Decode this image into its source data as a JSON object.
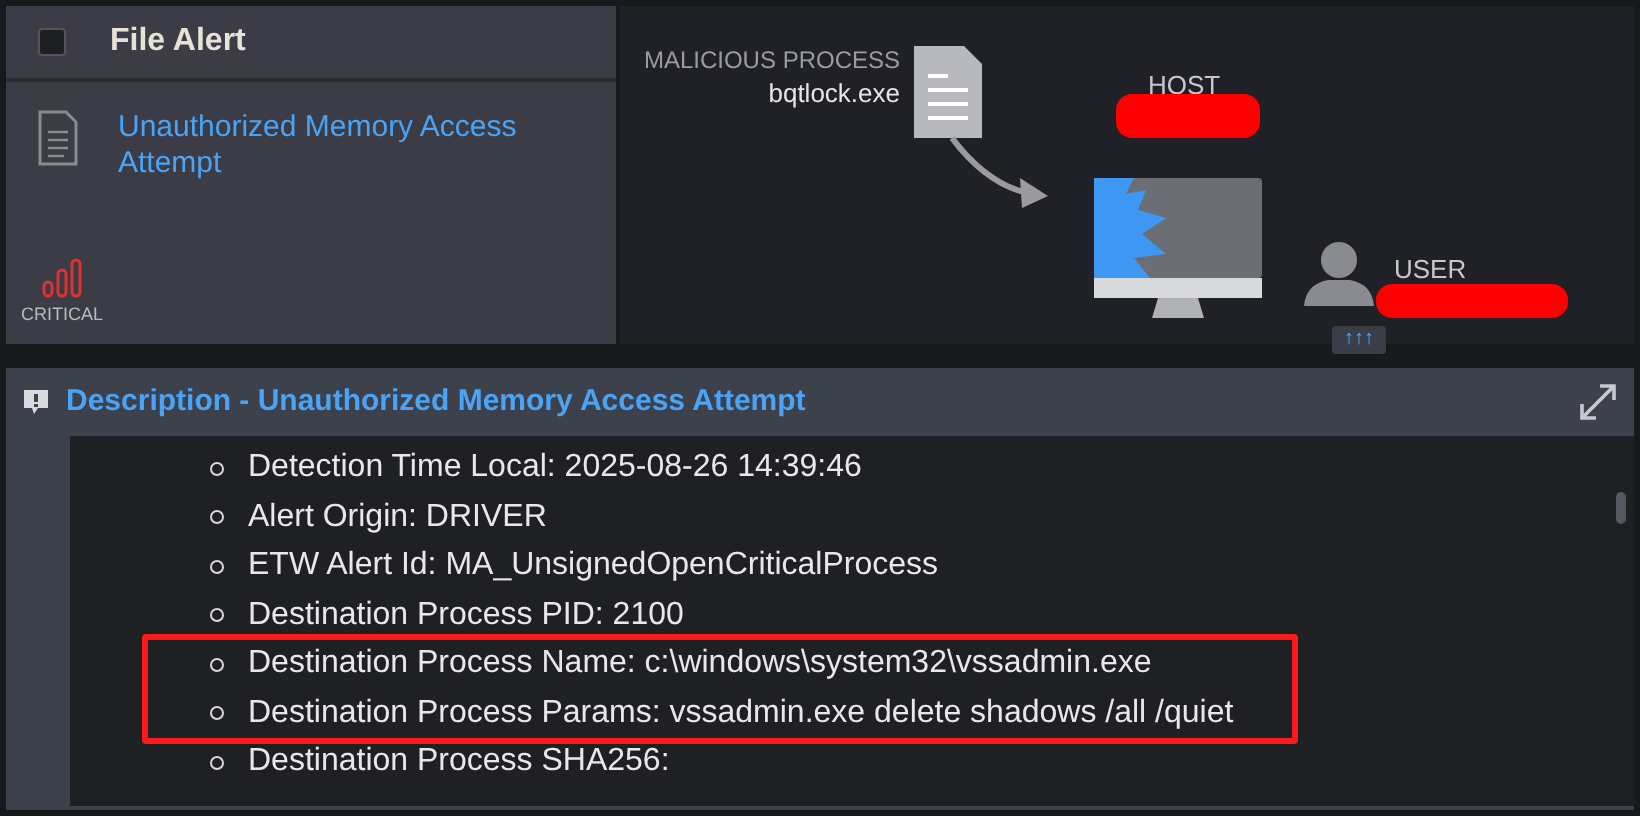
{
  "alert_card": {
    "checkbox": {
      "checked": false
    },
    "title": "File Alert",
    "name": "Unauthorized Memory Access Attempt",
    "severity": "CRITICAL"
  },
  "diagram": {
    "process_label": "MALICIOUS PROCESS",
    "process_name": "bqtlock.exe",
    "host_label": "HOST",
    "user_label": "USER",
    "user_badge": "↑↑↑"
  },
  "description": {
    "title": "Description - Unauthorized Memory Access Attempt",
    "items": [
      {
        "text": "Detection Time Local: 2025-08-26 14:39:46",
        "highlighted": false
      },
      {
        "text": "Alert Origin: DRIVER",
        "highlighted": false
      },
      {
        "text": "ETW Alert Id: MA_UnsignedOpenCriticalProcess",
        "highlighted": false
      },
      {
        "text": "Destination Process PID: 2100",
        "highlighted": false
      },
      {
        "text": "Destination Process Name: c:\\windows\\system32\\vssadmin.exe",
        "highlighted": true
      },
      {
        "text": "Destination Process Params: vssadmin.exe delete shadows /all /quiet",
        "highlighted": true
      },
      {
        "text": "Destination Process SHA256:",
        "highlighted": false
      }
    ]
  }
}
